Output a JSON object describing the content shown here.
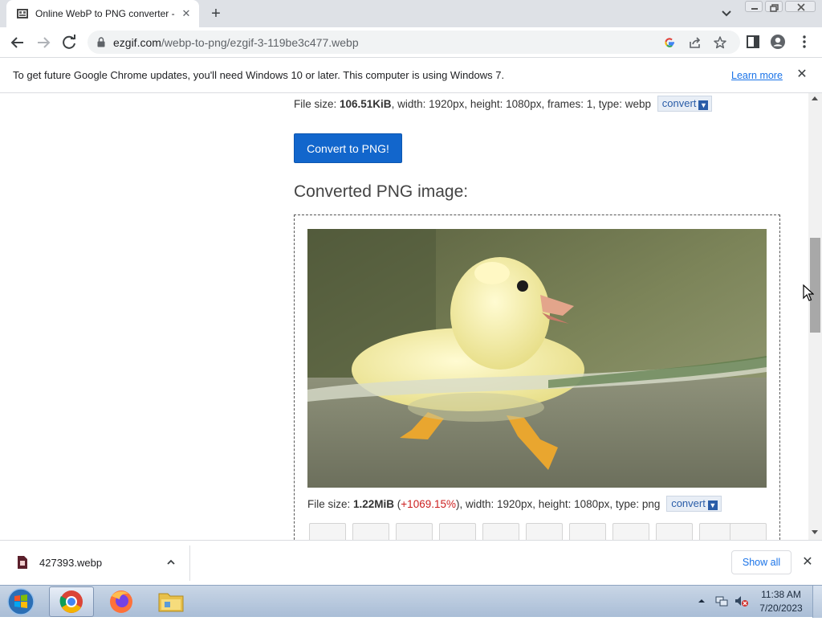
{
  "tab": {
    "title": "Online WebP to PNG converter -",
    "close": "✕",
    "new_tab": "+"
  },
  "address": {
    "domain": "ezgif.com",
    "path": "/webp-to-png/ezgif-3-119be3c477.webp"
  },
  "infobar": {
    "message": "To get future Google Chrome updates, you'll need Windows 10 or later. This computer is using Windows 7.",
    "learn_more": "Learn more",
    "close": "✕"
  },
  "source_file": {
    "label_size": "File size: ",
    "size": "106.51KiB",
    "details": ", width: 1920px, height: 1080px, frames: 1, type: webp",
    "convert_label": "convert"
  },
  "convert_button": "Convert to PNG!",
  "result": {
    "heading": "Converted PNG image:",
    "label_size": "File size: ",
    "size": "1.22MiB",
    "paren_open": " (",
    "percent": "+1069.15%",
    "details": "), width: 1920px, height: 1080px, type: png",
    "convert_label": "convert"
  },
  "download_bar": {
    "filename": "427393.webp",
    "show_all": "Show all",
    "close": "✕"
  },
  "taskbar": {
    "time": "11:38 AM",
    "date": "7/20/2023"
  },
  "colors": {
    "accent": "#1266cc",
    "link": "#1a73e8",
    "percent_red": "#cc1f1f"
  }
}
